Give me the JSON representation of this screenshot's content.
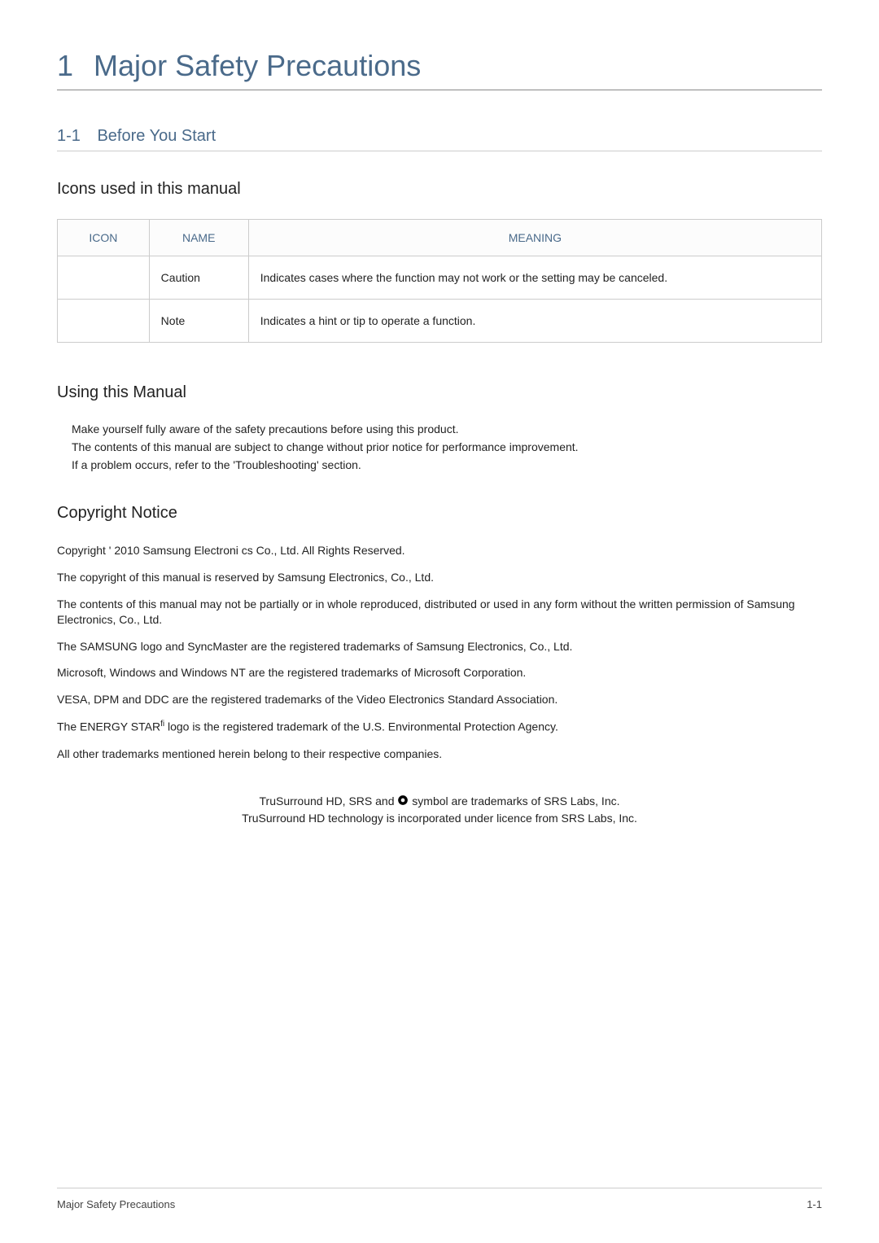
{
  "chapter": {
    "number": "1",
    "title": "Major Safety Precautions"
  },
  "section": {
    "number": "1-1",
    "title": "Before You Start"
  },
  "iconsHeading": "Icons used in this manual",
  "iconTable": {
    "headers": [
      "ICON",
      "NAME",
      "MEANING"
    ],
    "rows": [
      {
        "icon": "",
        "name": "Caution",
        "meaning": "Indicates cases where the function may not work or the setting may be canceled."
      },
      {
        "icon": "",
        "name": "Note",
        "meaning": "Indicates a hint or tip to operate a function."
      }
    ]
  },
  "usingManual": {
    "heading": "Using this Manual",
    "bullets": [
      "Make yourself fully aware of the safety precautions before using this product.",
      "The contents of this manual are subject to change without prior notice for performance improvement.",
      "If a problem occurs, refer to the 'Troubleshooting' section."
    ]
  },
  "copyrightNotice": {
    "heading": "Copyright Notice",
    "lines": [
      "Copyright '  2010 Samsung Electroni    cs Co., Ltd. All Rights Reserved.",
      "The copyright of this manual is reserved by Samsung Electronics, Co., Ltd.",
      "The contents of this manual may not be partially or in whole reproduced, distributed or used in any form without the written permission of Samsung Electronics, Co., Ltd.",
      "The SAMSUNG logo and SyncMaster are the registered trademarks of Samsung Electronics, Co., Ltd.",
      "Microsoft, Windows and Windows NT are the registered trademarks of Microsoft Corporation.",
      "VESA, DPM and DDC are the registered trademarks of the Video Electronics Standard Association."
    ],
    "energyStarPrefix": "The ENERGY STAR",
    "energyStarSup": "fi",
    "energyStarSuffix": " logo is the registered trademark of the U.S. Environmental Protection Agency.",
    "lastLine": "All other trademarks mentioned herein belong to their respective companies."
  },
  "srs": {
    "line1Prefix": "TruSurround HD, SRS and ",
    "line1Suffix": " symbol are trademarks of SRS Labs, Inc.",
    "line2": "TruSurround HD technology is incorporated under licence from SRS Labs, Inc."
  },
  "footer": {
    "left": "Major Safety Precautions",
    "right": "1-1"
  }
}
